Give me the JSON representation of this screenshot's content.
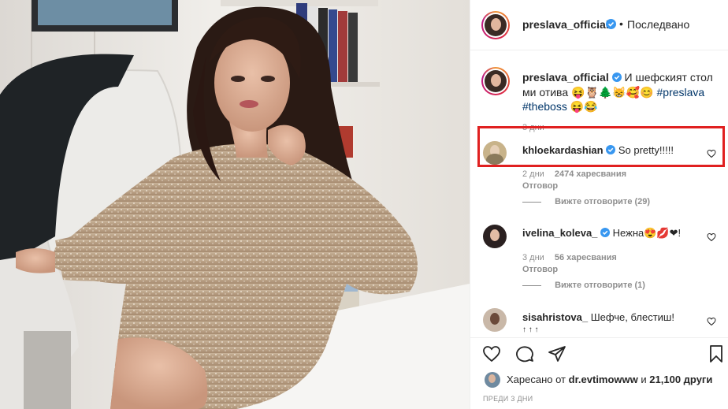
{
  "post": {
    "author": "preslava_official",
    "dot": "•",
    "follow_status": "Последвано",
    "caption_text": "И шефският стол ми отива",
    "caption_emoji": "😝🦉🌲😸🥰😊",
    "hashtag1": "#preslava",
    "hashtag2": "#theboss",
    "caption_emoji2": "😝😂",
    "caption_time": "3 дни"
  },
  "comments": [
    {
      "user": "khloekardashian",
      "text": "So pretty!!!!!",
      "time": "2 дни",
      "likes": "2474 харесвания",
      "reply": "Отговор",
      "view_replies": "Вижте отговорите (29)"
    },
    {
      "user": "ivelina_koleva_",
      "text": "Нежна",
      "emoji": "😍💋❤",
      "exclaim": "!",
      "time": "3 дни",
      "likes": "56 харесвания",
      "reply": "Отговор",
      "view_replies": "Вижте отговорите (1)"
    },
    {
      "user": "sisahristova_",
      "text": "Шефче, блестиш!",
      "arrows": "↑ ↑ ↑"
    }
  ],
  "footer": {
    "liked_by_prefix": "Харесано от",
    "liked_by_user": "dr.evtimowww",
    "liked_and": "и",
    "liked_count": "21,100 други",
    "posted_ago": "ПРЕДИ 3 ДНИ"
  },
  "colors": {
    "link": "#003569",
    "verified": "#3897f0",
    "highlight": "#e02020",
    "muted": "#8e8e8e"
  },
  "icons": [
    "heart-icon",
    "comment-icon",
    "share-icon",
    "bookmark-icon",
    "verified-badge-icon"
  ]
}
